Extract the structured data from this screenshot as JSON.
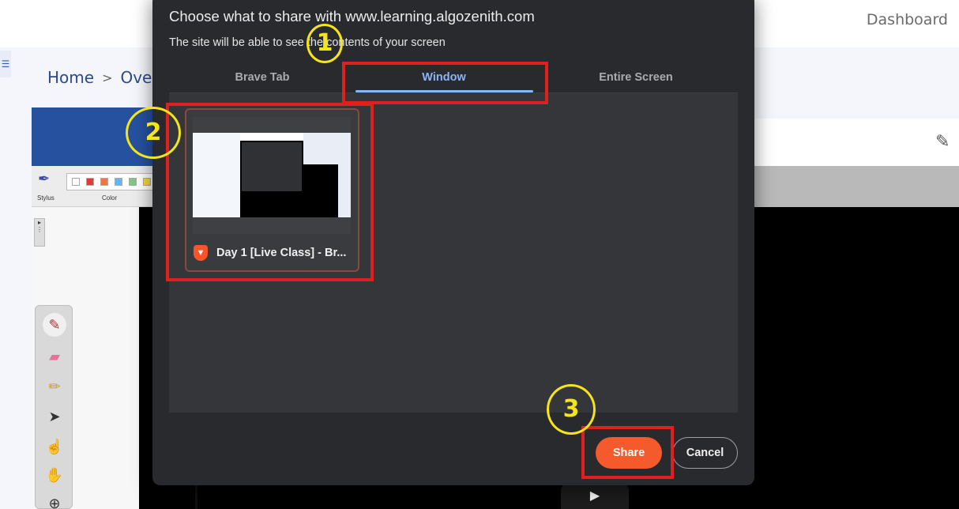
{
  "background": {
    "dashboard_link": "Dashboard",
    "breadcrumb": {
      "home": "Home",
      "separator": ">",
      "current": "Ove"
    },
    "whiteboard": {
      "stylus_label": "Stylus",
      "color_label": "Color",
      "swatches": [
        "#ffffff",
        "#e53935",
        "#ff7043",
        "#64b5f6",
        "#81c784",
        "#fdd835"
      ]
    }
  },
  "dialog": {
    "title": "Choose what to share with www.learning.algozenith.com",
    "subtitle": "The site will be able to see the contents of your screen",
    "tabs": [
      {
        "label": "Brave Tab",
        "active": false
      },
      {
        "label": "Window",
        "active": true
      },
      {
        "label": "Entire Screen",
        "active": false
      }
    ],
    "windows": [
      {
        "title": "Day 1 [Live Class] - Br...",
        "app_icon": "brave-browser-icon"
      }
    ],
    "share_label": "Share",
    "cancel_label": "Cancel",
    "accent_color": "#8ab4f8",
    "share_color": "#f55a2c"
  },
  "annotations": {
    "steps": [
      "1",
      "2",
      "3"
    ],
    "circle_color": "#f4e51a",
    "box_color": "#e02020"
  }
}
